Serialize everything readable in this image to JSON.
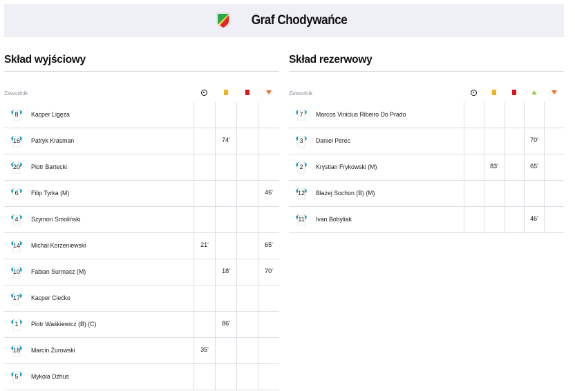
{
  "team": {
    "name": "Graf Chodywańce",
    "crest_colors": [
      "#2aa84a",
      "#e5232b",
      "#f5d327"
    ]
  },
  "colors": {
    "header_bg": "#eef0f6",
    "shirt_white": "#ffffff",
    "shirt_teal": "#1aa6c9",
    "yellow_card": "#f5b21b",
    "red_card": "#e0161e",
    "sub_in": "#8fd14b",
    "sub_out": "#f26b21"
  },
  "starting": {
    "title": "Skład wyjściowy",
    "player_col_label": "Zawodnik",
    "columns": [
      {
        "key": "goal",
        "icon": "football-icon"
      },
      {
        "key": "yellow",
        "icon": "yellow-card-icon"
      },
      {
        "key": "red",
        "icon": "red-card-icon"
      },
      {
        "key": "out",
        "icon": "substitution-out-icon"
      }
    ],
    "players": [
      {
        "number": "8",
        "name": "Kacper Ligęza",
        "goal": "",
        "yellow": "",
        "red": "",
        "out": ""
      },
      {
        "number": "16",
        "name": "Patryk Krasman",
        "goal": "",
        "yellow": "74'",
        "red": "",
        "out": ""
      },
      {
        "number": "20",
        "name": "Piotr Bartecki",
        "goal": "",
        "yellow": "",
        "red": "",
        "out": ""
      },
      {
        "number": "6",
        "name": "Filip Tyrka (M)",
        "goal": "",
        "yellow": "",
        "red": "",
        "out": "46'"
      },
      {
        "number": "4",
        "name": "Szymon Smoliński",
        "goal": "",
        "yellow": "",
        "red": "",
        "out": ""
      },
      {
        "number": "14",
        "name": "Michał Korzeniewski",
        "goal": "21'",
        "yellow": "",
        "red": "",
        "out": "65'"
      },
      {
        "number": "10",
        "name": "Fabian Surmacz (M)",
        "goal": "",
        "yellow": "18'",
        "red": "",
        "out": "70'"
      },
      {
        "number": "17",
        "name": "Kacper Ciećko",
        "goal": "",
        "yellow": "",
        "red": "",
        "out": ""
      },
      {
        "number": "1",
        "name": "Piotr Waśkiewicz (B) (C)",
        "goal": "",
        "yellow": "86'",
        "red": "",
        "out": ""
      },
      {
        "number": "18",
        "name": "Marcin Żurowski",
        "goal": "35'",
        "yellow": "",
        "red": "",
        "out": ""
      },
      {
        "number": "5",
        "name": "Mykola Dzhus",
        "goal": "",
        "yellow": "",
        "red": "",
        "out": ""
      }
    ]
  },
  "reserves": {
    "title": "Skład rezerwowy",
    "player_col_label": "Zawodnik",
    "columns": [
      {
        "key": "goal",
        "icon": "football-icon"
      },
      {
        "key": "yellow",
        "icon": "yellow-card-icon"
      },
      {
        "key": "red",
        "icon": "red-card-icon"
      },
      {
        "key": "in",
        "icon": "substitution-in-icon"
      },
      {
        "key": "out",
        "icon": "substitution-out-icon"
      }
    ],
    "players": [
      {
        "number": "7",
        "name": "Marcos Vinicius Ribeiro Do Prado",
        "goal": "",
        "yellow": "",
        "red": "",
        "in": "",
        "out": ""
      },
      {
        "number": "3",
        "name": "Daniel Perec",
        "goal": "",
        "yellow": "",
        "red": "",
        "in": "70'",
        "out": ""
      },
      {
        "number": "2",
        "name": "Krystian Frykowski (M)",
        "goal": "",
        "yellow": "83'",
        "red": "",
        "in": "65'",
        "out": ""
      },
      {
        "number": "12",
        "name": "Błażej Sochon (B) (M)",
        "goal": "",
        "yellow": "",
        "red": "",
        "in": "",
        "out": ""
      },
      {
        "number": "11",
        "name": "Ivan Bobyliak",
        "goal": "",
        "yellow": "",
        "red": "",
        "in": "46'",
        "out": ""
      }
    ]
  }
}
